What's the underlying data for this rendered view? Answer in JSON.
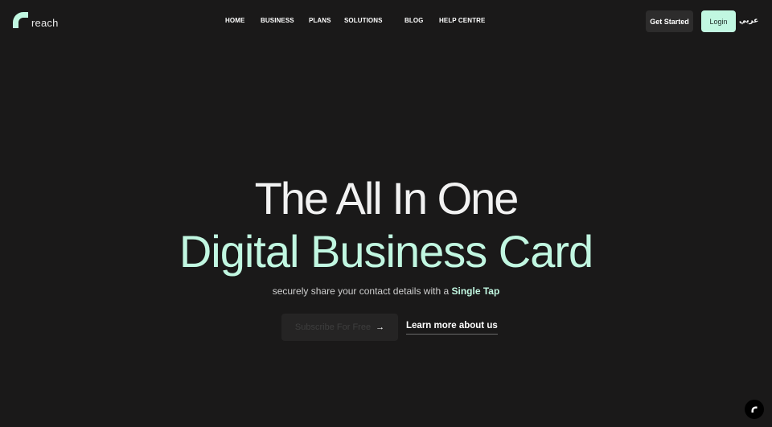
{
  "brand": {
    "name": "reach",
    "logo_icon": "reach-arc-icon",
    "accent": "#c1f7e1"
  },
  "nav": {
    "items": [
      {
        "label": "HOME"
      },
      {
        "label": "BUSINESS"
      },
      {
        "label": "PLANS"
      },
      {
        "label": "SOLUTIONS"
      },
      {
        "label": "BLOG"
      },
      {
        "label": "HELP CENTRE"
      }
    ]
  },
  "header": {
    "get_started": "Get Started",
    "login": "Login",
    "language": "عربي"
  },
  "hero": {
    "line1": "The All In One",
    "line2": "Digital Business Card",
    "subtitle_prefix": "securely share your contact details with a ",
    "subtitle_emphasis": "Single Tap",
    "subscribe_label": "Subscribe For Free",
    "subscribe_arrow": "→",
    "learn_more": "Learn more about us"
  },
  "floating": {
    "icon": "reach-chat-icon"
  },
  "colors": {
    "background": "#1a1919",
    "accent": "#c1f7e1",
    "button_dark": "#2d2c2c"
  }
}
